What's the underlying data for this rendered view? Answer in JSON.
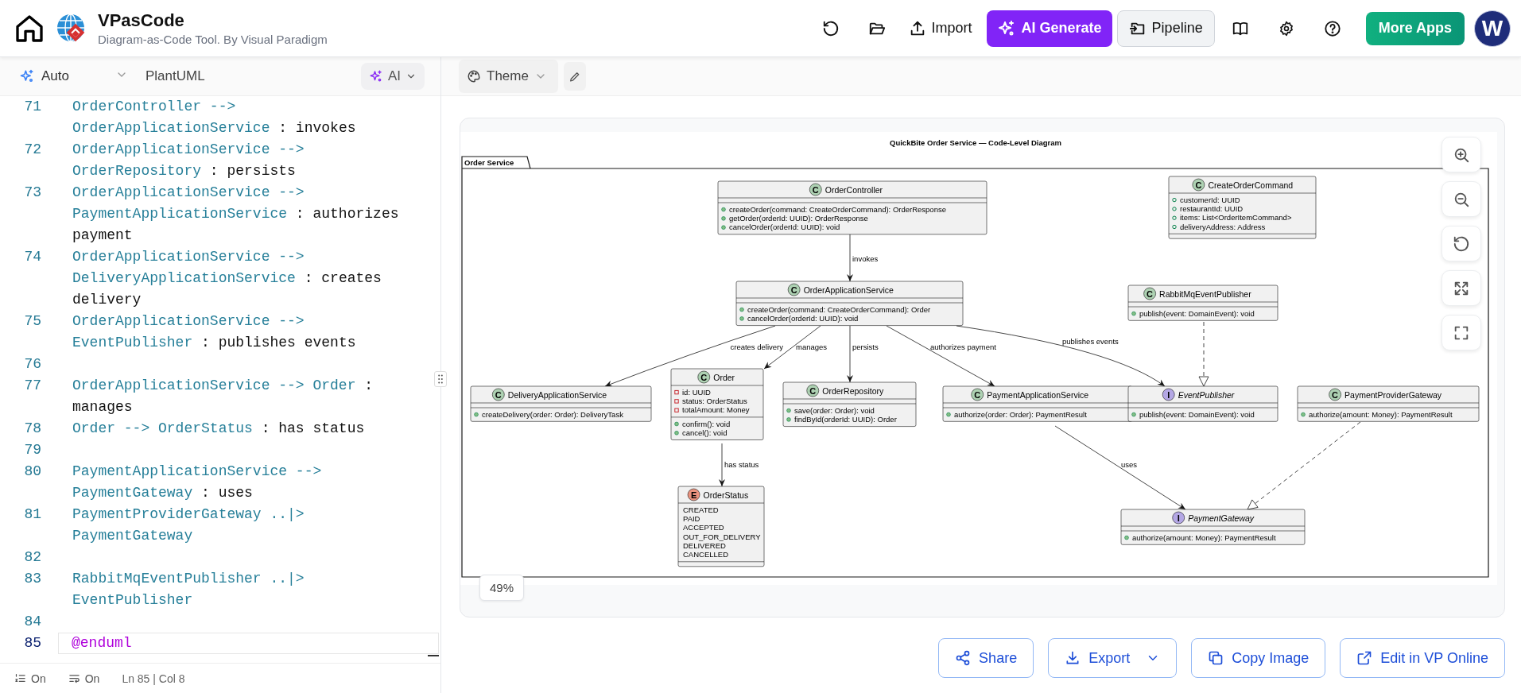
{
  "header": {
    "title": "VPasCode",
    "subtitle": "Diagram-as-Code Tool. By Visual Paradigm",
    "import_button": "Import",
    "ai_generate_button": "AI Generate",
    "pipeline_button": "Pipeline",
    "more_apps_button": "More Apps",
    "avatar": "W"
  },
  "editor": {
    "mode": "Auto",
    "language": "PlantUML",
    "ai_button": "AI",
    "lines": [
      {
        "number": "71",
        "current": false,
        "segments": [
          {
            "text": "OrderController --> OrderApplicationService",
            "kind": "relation"
          },
          {
            "text": ": invokes",
            "kind": "label"
          }
        ]
      },
      {
        "number": "72",
        "current": false,
        "segments": [
          {
            "text": "OrderApplicationService --> OrderRepository",
            "kind": "relation"
          },
          {
            "text": ": persists",
            "kind": "label"
          }
        ]
      },
      {
        "number": "73",
        "current": false,
        "segments": [
          {
            "text": "OrderApplicationService --> PaymentApplicationService",
            "kind": "relation"
          },
          {
            "text": ": authorizes payment",
            "kind": "label"
          }
        ]
      },
      {
        "number": "74",
        "current": false,
        "segments": [
          {
            "text": "OrderApplicationService --> DeliveryApplicationService",
            "kind": "relation"
          },
          {
            "text": ": creates delivery",
            "kind": "label"
          }
        ]
      },
      {
        "number": "75",
        "current": false,
        "segments": [
          {
            "text": "OrderApplicationService --> EventPublisher",
            "kind": "relation"
          },
          {
            "text": ": publishes events",
            "kind": "label"
          }
        ]
      },
      {
        "number": "76",
        "current": false
      },
      {
        "number": "77",
        "current": false,
        "segments": [
          {
            "text": "OrderApplicationService --> Order",
            "kind": "relation"
          },
          {
            "text": ": manages",
            "kind": "label"
          }
        ]
      },
      {
        "number": "78",
        "current": false,
        "segments": [
          {
            "text": "Order --> OrderStatus",
            "kind": "relation"
          },
          {
            "text": ": has status",
            "kind": "label"
          }
        ]
      },
      {
        "number": "79",
        "current": false
      },
      {
        "number": "80",
        "current": false,
        "segments": [
          {
            "text": "PaymentApplicationService --> PaymentGateway",
            "kind": "relation"
          },
          {
            "text": ": uses",
            "kind": "label"
          }
        ]
      },
      {
        "number": "81",
        "current": false,
        "segments": [
          {
            "text": "PaymentProviderGateway ..|> PaymentGateway",
            "kind": "relation"
          }
        ]
      },
      {
        "number": "82",
        "current": false
      },
      {
        "number": "83",
        "current": false,
        "segments": [
          {
            "text": "RabbitMqEventPublisher ..|> EventPublisher",
            "kind": "relation"
          }
        ]
      },
      {
        "number": "84",
        "current": false
      },
      {
        "number": "85",
        "current": true,
        "segments": [
          {
            "text": "@enduml",
            "kind": "directive"
          }
        ]
      }
    ],
    "status": {
      "line_numbers": "On",
      "word_wrap": "On",
      "position": "Ln 85 | Col 8"
    }
  },
  "preview": {
    "theme_button": "Theme",
    "zoom": "49%",
    "actions": [
      {
        "label": "Share",
        "has_menu": false
      },
      {
        "label": "Export",
        "has_menu": true
      },
      {
        "label": "Copy Image",
        "has_menu": false
      },
      {
        "label": "Edit in VP Online",
        "has_menu": false
      }
    ],
    "diagram": {
      "title": "QuickBite Order Service — Code-Level Diagram",
      "package": "Order Service",
      "classes": [
        {
          "name": "OrderController",
          "kind": "class",
          "badge": "C",
          "methods": [
            {
              "text": "createOrder(command: CreateOrderCommand): OrderResponse",
              "kind": "public"
            },
            {
              "text": "getOrder(orderId: UUID): OrderResponse",
              "kind": "public"
            },
            {
              "text": "cancelOrder(orderId: UUID): void",
              "kind": "public"
            }
          ]
        },
        {
          "name": "CreateOrderCommand",
          "kind": "class",
          "badge": "C",
          "attributes": [
            {
              "text": "customerId: UUID",
              "kind": "public"
            },
            {
              "text": "restaurantId: UUID",
              "kind": "public"
            },
            {
              "text": "items: List<OrderItemCommand>",
              "kind": "public"
            },
            {
              "text": "deliveryAddress: Address",
              "kind": "public"
            }
          ]
        },
        {
          "name": "OrderApplicationService",
          "kind": "class",
          "badge": "C",
          "methods": [
            {
              "text": "createOrder(command: CreateOrderCommand): Order",
              "kind": "public"
            },
            {
              "text": "cancelOrder(orderId: UUID): void",
              "kind": "public"
            }
          ]
        },
        {
          "name": "RabbitMqEventPublisher",
          "kind": "class",
          "badge": "C",
          "methods": [
            {
              "text": "publish(event: DomainEvent): void",
              "kind": "public"
            }
          ]
        },
        {
          "name": "DeliveryApplicationService",
          "kind": "class",
          "badge": "C",
          "methods": [
            {
              "text": "createDelivery(order: Order): DeliveryTask",
              "kind": "public"
            }
          ]
        },
        {
          "name": "Order",
          "kind": "class",
          "badge": "C",
          "attributes": [
            {
              "text": "id: UUID",
              "kind": "private"
            },
            {
              "text": "status: OrderStatus",
              "kind": "private"
            },
            {
              "text": "totalAmount: Money",
              "kind": "private"
            }
          ],
          "methods": [
            {
              "text": "confirm(): void",
              "kind": "public"
            },
            {
              "text": "cancel(): void",
              "kind": "public"
            }
          ]
        },
        {
          "name": "OrderRepository",
          "kind": "class",
          "badge": "C",
          "methods": [
            {
              "text": "save(order: Order): void",
              "kind": "public"
            },
            {
              "text": "findById(orderId: UUID): Order",
              "kind": "public"
            }
          ]
        },
        {
          "name": "PaymentApplicationService",
          "kind": "class",
          "badge": "C",
          "methods": [
            {
              "text": "authorize(order: Order): PaymentResult",
              "kind": "public"
            }
          ]
        },
        {
          "name": "EventPublisher",
          "kind": "interface",
          "badge": "I",
          "methods": [
            {
              "text": "publish(event: DomainEvent): void",
              "kind": "public"
            }
          ]
        },
        {
          "name": "PaymentProviderGateway",
          "kind": "class",
          "badge": "C",
          "methods": [
            {
              "text": "authorize(amount: Money): PaymentResult",
              "kind": "public"
            }
          ]
        },
        {
          "name": "OrderStatus",
          "kind": "enum",
          "badge": "E",
          "constants": [
            "CREATED",
            "PAID",
            "ACCEPTED",
            "OUT_FOR_DELIVERY",
            "DELIVERED",
            "CANCELLED"
          ]
        },
        {
          "name": "PaymentGateway",
          "kind": "interface",
          "badge": "I",
          "methods": [
            {
              "text": "authorize(amount: Money): PaymentResult",
              "kind": "public"
            }
          ]
        }
      ],
      "relations": [
        {
          "kind": "association",
          "label": "invokes"
        },
        {
          "kind": "association",
          "label": "creates delivery"
        },
        {
          "kind": "association",
          "label": "manages"
        },
        {
          "kind": "association",
          "label": "persists"
        },
        {
          "kind": "association",
          "label": "authorizes payment"
        },
        {
          "kind": "association",
          "label": "publishes events"
        },
        {
          "kind": "association",
          "label": "has status"
        },
        {
          "kind": "association",
          "label": "uses"
        },
        {
          "kind": "realization"
        },
        {
          "kind": "realization"
        }
      ]
    }
  }
}
